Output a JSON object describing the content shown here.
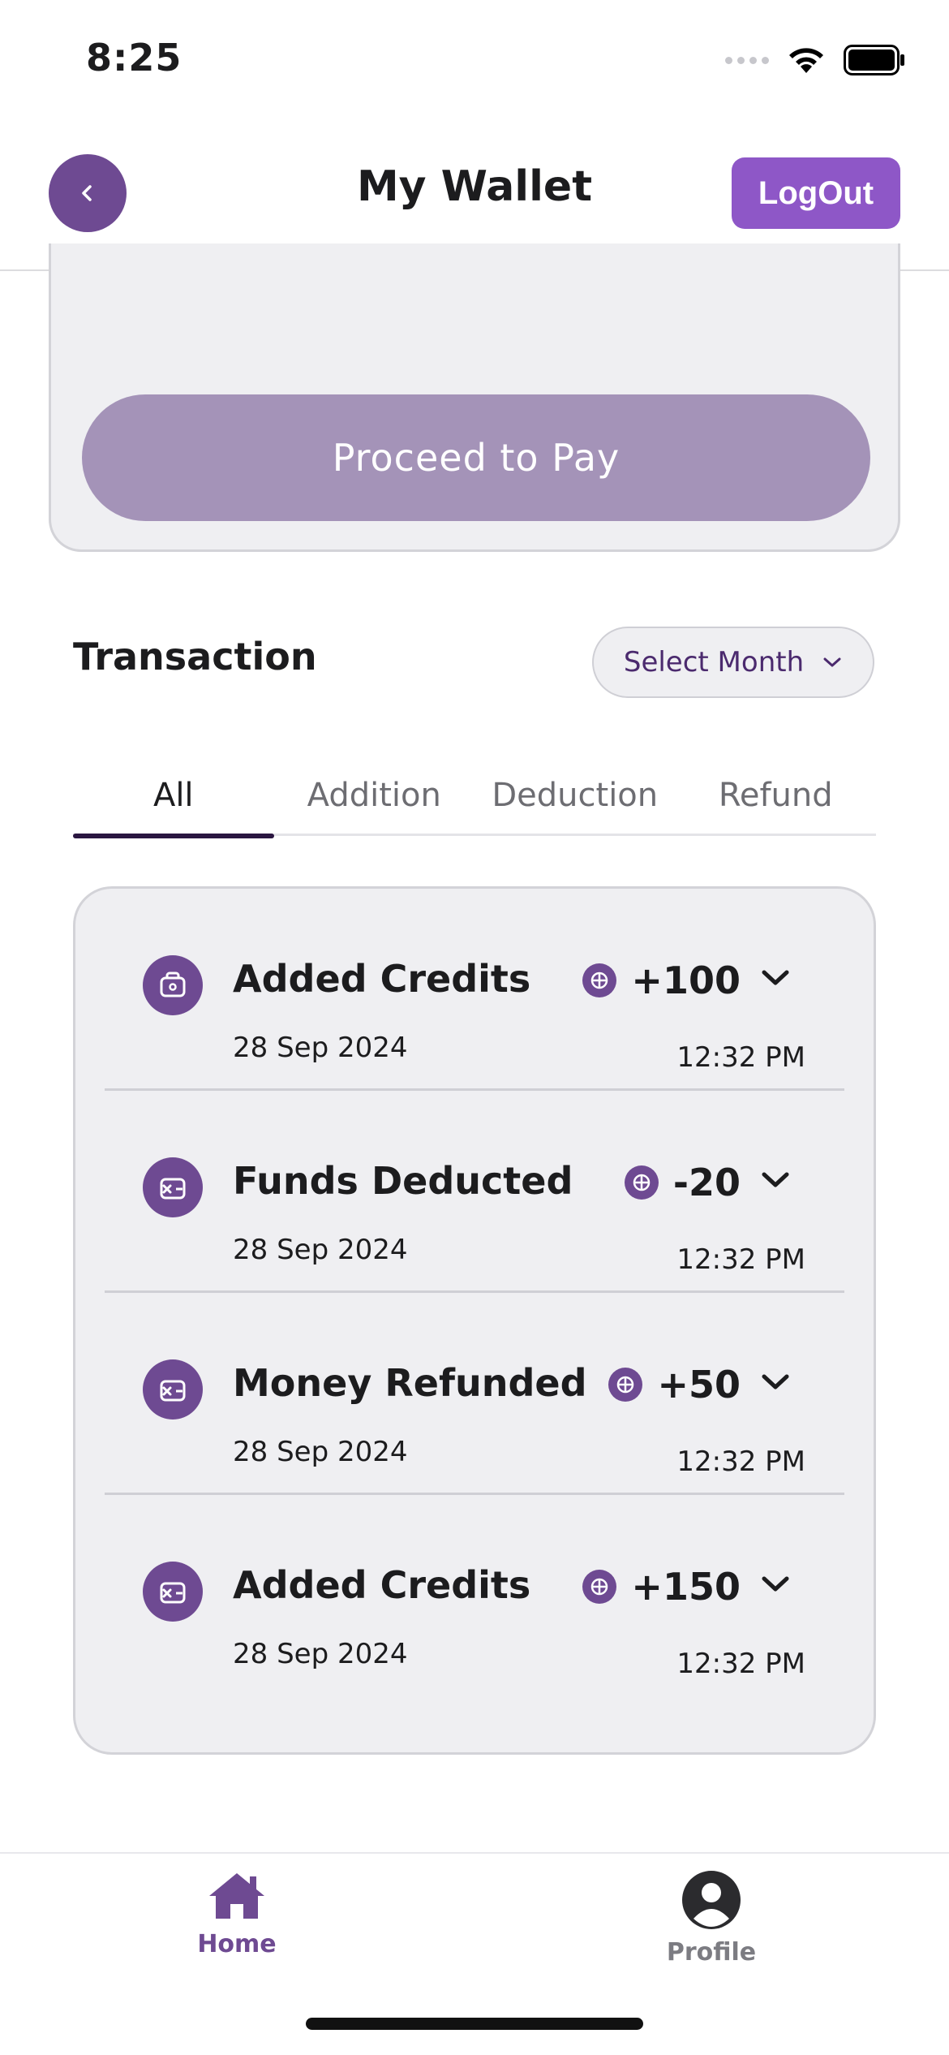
{
  "status_bar": {
    "time": "8:25",
    "icons": [
      "signal-icon",
      "wifi-icon",
      "battery-icon"
    ]
  },
  "header": {
    "title": "My Wallet",
    "back_icon": "chevron-left-icon",
    "logout_label": "LogOut"
  },
  "pay_card": {
    "proceed_label": "Proceed to Pay"
  },
  "transactions": {
    "title": "Transaction",
    "month_select": {
      "label": "Select Month",
      "icon": "chevron-down-icon"
    },
    "tabs": [
      {
        "label": "All",
        "active": true
      },
      {
        "label": "Addition",
        "active": false
      },
      {
        "label": "Deduction",
        "active": false
      },
      {
        "label": "Refund",
        "active": false
      }
    ],
    "items": [
      {
        "title": "Added Credits",
        "date": "28 Sep 2024",
        "amount": "+100",
        "time": "12:32 PM",
        "icon": "wallet-add-icon"
      },
      {
        "title": "Funds Deducted",
        "date": "28 Sep 2024",
        "amount": "-20",
        "time": "12:32 PM",
        "icon": "wallet-remove-icon"
      },
      {
        "title": "Money Refunded",
        "date": "28 Sep 2024",
        "amount": "+50",
        "time": "12:32 PM",
        "icon": "wallet-remove-icon"
      },
      {
        "title": "Added Credits",
        "date": "28 Sep 2024",
        "amount": "+150",
        "time": "12:32 PM",
        "icon": "wallet-remove-icon"
      }
    ]
  },
  "bottom_nav": {
    "items": [
      {
        "label": "Home",
        "icon": "home-icon",
        "active": true
      },
      {
        "label": "Profile",
        "icon": "profile-icon",
        "active": false
      }
    ]
  },
  "colors": {
    "brand": "#6e4a92",
    "logout": "#8e57c7",
    "proceed": "#a493b8",
    "card_bg": "#efeff2"
  }
}
